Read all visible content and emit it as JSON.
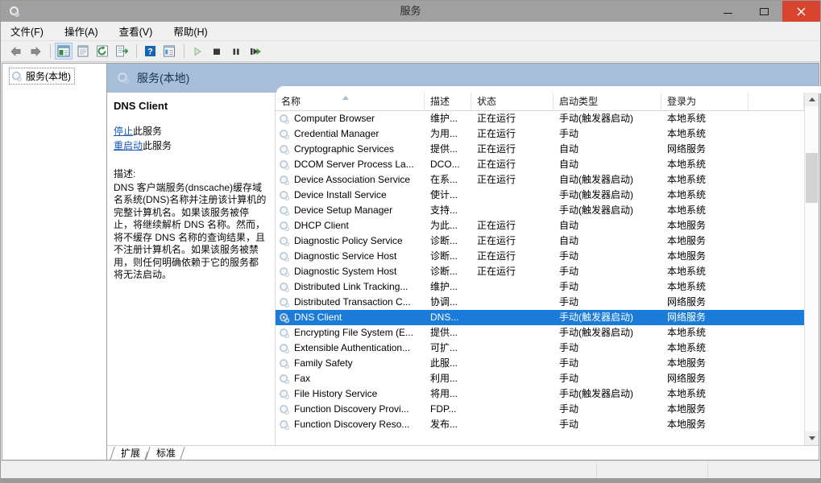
{
  "window": {
    "title": "服务",
    "app_icon": "services-gear-icon",
    "controls": {
      "minimize": "最小化",
      "maximize": "最大化",
      "close": "关闭"
    }
  },
  "menubar": {
    "items": [
      {
        "label": "文件(F)",
        "name": "menu-file"
      },
      {
        "label": "操作(A)",
        "name": "menu-action"
      },
      {
        "label": "查看(V)",
        "name": "menu-view"
      },
      {
        "label": "帮助(H)",
        "name": "menu-help"
      }
    ]
  },
  "toolbar": {
    "buttons": [
      {
        "name": "back-icon",
        "glyph": "back"
      },
      {
        "name": "forward-icon",
        "glyph": "forward"
      },
      {
        "name": "show-hide-tree-icon",
        "glyph": "tree",
        "active": true
      },
      {
        "name": "properties-icon",
        "glyph": "properties"
      },
      {
        "name": "refresh-icon",
        "glyph": "refresh"
      },
      {
        "name": "export-list-icon",
        "glyph": "export"
      },
      {
        "name": "help-icon",
        "glyph": "help"
      },
      {
        "name": "show-list-icon",
        "glyph": "list"
      },
      {
        "name": "start-service-icon",
        "glyph": "play"
      },
      {
        "name": "stop-service-icon",
        "glyph": "stop"
      },
      {
        "name": "pause-service-icon",
        "glyph": "pause"
      },
      {
        "name": "restart-service-icon",
        "glyph": "restart"
      }
    ]
  },
  "tree": {
    "root_label": "服务(本地)"
  },
  "pane_header": {
    "title": "服务(本地)",
    "icon": "services-gear-icon"
  },
  "details": {
    "service_name": "DNS Client",
    "links": [
      {
        "link_text": "停止",
        "suffix": "此服务",
        "name": "stop-service-link"
      },
      {
        "link_text": "重启动",
        "suffix": "此服务",
        "name": "restart-service-link"
      }
    ],
    "description_label": "描述:",
    "description_text": "DNS 客户端服务(dnscache)缓存域名系统(DNS)名称并注册该计算机的完整计算机名。如果该服务被停止，将继续解析 DNS 名称。然而，将不缓存 DNS 名称的查询结果，且不注册计算机名。如果该服务被禁用，则任何明确依赖于它的服务都将无法启动。"
  },
  "table": {
    "columns": [
      {
        "label": "名称",
        "width": 185,
        "sorted": "asc"
      },
      {
        "label": "描述",
        "width": 58
      },
      {
        "label": "状态",
        "width": 102
      },
      {
        "label": "启动类型",
        "width": 134
      },
      {
        "label": "登录为",
        "width": 108
      },
      {
        "label": "",
        "width": 60
      }
    ],
    "rows": [
      {
        "name": "Computer Browser",
        "desc": "维护...",
        "status": "正在运行",
        "startup": "手动(触发器启动)",
        "logon": "本地系统",
        "selected": false
      },
      {
        "name": "Credential Manager",
        "desc": "为用...",
        "status": "正在运行",
        "startup": "手动",
        "logon": "本地系统",
        "selected": false
      },
      {
        "name": "Cryptographic Services",
        "desc": "提供...",
        "status": "正在运行",
        "startup": "自动",
        "logon": "网络服务",
        "selected": false
      },
      {
        "name": "DCOM Server Process La...",
        "desc": "DCO...",
        "status": "正在运行",
        "startup": "自动",
        "logon": "本地系统",
        "selected": false
      },
      {
        "name": "Device Association Service",
        "desc": "在系...",
        "status": "正在运行",
        "startup": "自动(触发器启动)",
        "logon": "本地系统",
        "selected": false
      },
      {
        "name": "Device Install Service",
        "desc": "使计...",
        "status": "",
        "startup": "手动(触发器启动)",
        "logon": "本地系统",
        "selected": false
      },
      {
        "name": "Device Setup Manager",
        "desc": "支持...",
        "status": "",
        "startup": "手动(触发器启动)",
        "logon": "本地系统",
        "selected": false
      },
      {
        "name": "DHCP Client",
        "desc": "为此...",
        "status": "正在运行",
        "startup": "自动",
        "logon": "本地服务",
        "selected": false
      },
      {
        "name": "Diagnostic Policy Service",
        "desc": "诊断...",
        "status": "正在运行",
        "startup": "自动",
        "logon": "本地服务",
        "selected": false
      },
      {
        "name": "Diagnostic Service Host",
        "desc": "诊断...",
        "status": "正在运行",
        "startup": "手动",
        "logon": "本地服务",
        "selected": false
      },
      {
        "name": "Diagnostic System Host",
        "desc": "诊断...",
        "status": "正在运行",
        "startup": "手动",
        "logon": "本地系统",
        "selected": false
      },
      {
        "name": "Distributed Link Tracking...",
        "desc": "维护...",
        "status": "",
        "startup": "手动",
        "logon": "本地系统",
        "selected": false
      },
      {
        "name": "Distributed Transaction C...",
        "desc": "协调...",
        "status": "",
        "startup": "手动",
        "logon": "网络服务",
        "selected": false
      },
      {
        "name": "DNS Client",
        "desc": "DNS...",
        "status": "",
        "startup": "手动(触发器启动)",
        "logon": "网络服务",
        "selected": true
      },
      {
        "name": "Encrypting File System (E...",
        "desc": "提供...",
        "status": "",
        "startup": "手动(触发器启动)",
        "logon": "本地系统",
        "selected": false
      },
      {
        "name": "Extensible Authentication...",
        "desc": "可扩...",
        "status": "",
        "startup": "手动",
        "logon": "本地系统",
        "selected": false
      },
      {
        "name": "Family Safety",
        "desc": "此服...",
        "status": "",
        "startup": "手动",
        "logon": "本地服务",
        "selected": false
      },
      {
        "name": "Fax",
        "desc": "利用...",
        "status": "",
        "startup": "手动",
        "logon": "网络服务",
        "selected": false
      },
      {
        "name": "File History Service",
        "desc": "将用...",
        "status": "",
        "startup": "手动(触发器启动)",
        "logon": "本地系统",
        "selected": false
      },
      {
        "name": "Function Discovery Provi...",
        "desc": "FDP...",
        "status": "",
        "startup": "手动",
        "logon": "本地服务",
        "selected": false
      },
      {
        "name": "Function Discovery Reso...",
        "desc": "发布...",
        "status": "",
        "startup": "手动",
        "logon": "本地服务",
        "selected": false
      }
    ]
  },
  "tabs": [
    {
      "label": "扩展",
      "name": "tab-extended"
    },
    {
      "label": "标准",
      "name": "tab-standard"
    }
  ],
  "statusbar": {
    "segments": [
      "",
      "",
      ""
    ]
  },
  "colors": {
    "selection": "#1a7cd8",
    "header_band": "#a7bed8",
    "titlebar": "#a0a0a0",
    "close_button": "#d9442e",
    "link": "#1959b5"
  }
}
